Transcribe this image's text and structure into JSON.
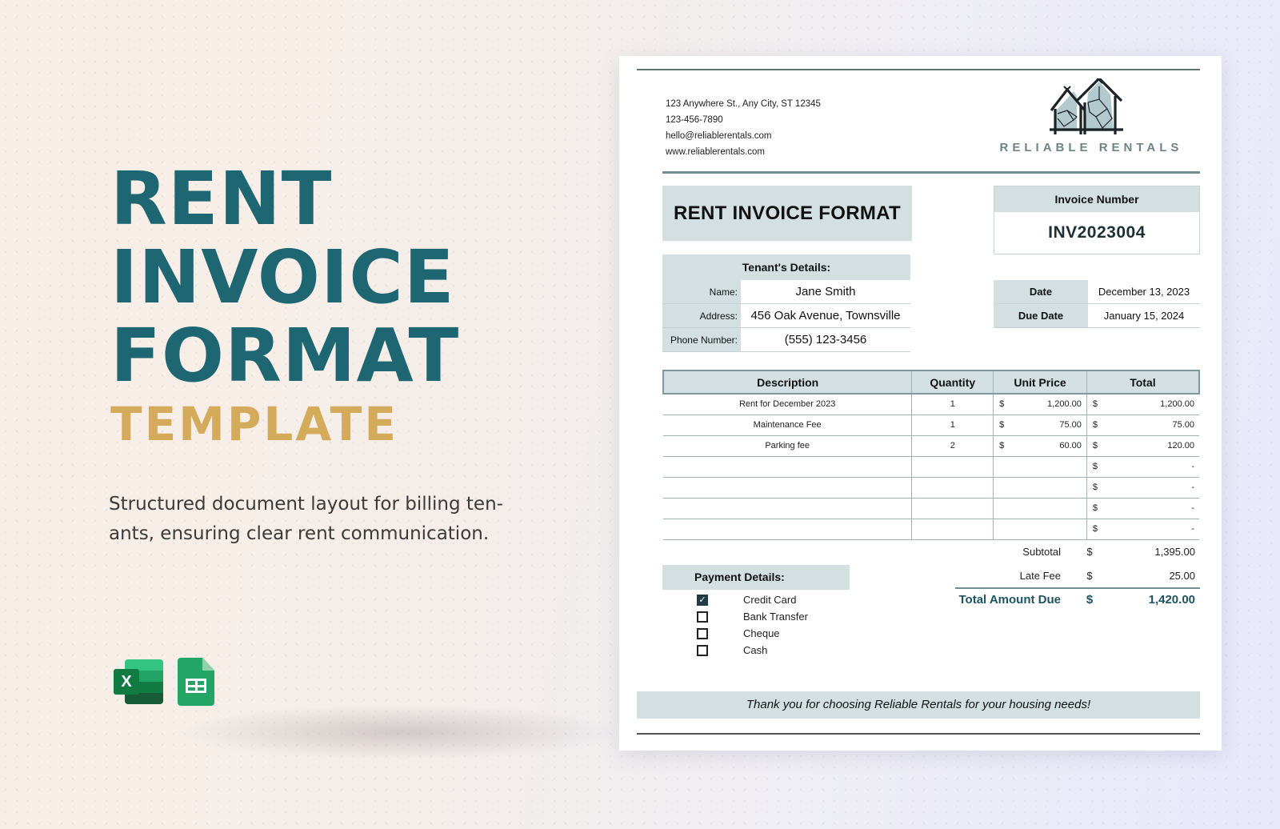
{
  "hero": {
    "title_lines": [
      "RENT",
      "INVOICE",
      "FORMAT"
    ],
    "subtitle": "TEMPLATE",
    "description_lines": [
      "Structured document layout for billing ten-",
      "ants, ensuring clear rent communication."
    ],
    "app_icons": [
      {
        "name": "excel-icon",
        "glyph": "X"
      },
      {
        "name": "google-sheets-icon"
      }
    ],
    "colors": {
      "title": "#1d6672",
      "subtitle": "#d4aa5b"
    }
  },
  "invoice": {
    "contact": {
      "address": "123 Anywhere St., Any City, ST 12345",
      "phone": "123-456-7890",
      "email": "hello@reliablerentals.com",
      "website": "www.reliablerentals.com"
    },
    "brand": {
      "name": "RELIABLE RENTALS",
      "logo_icon": "houses-logo-icon"
    },
    "title": "RENT INVOICE FORMAT",
    "invoice_number": {
      "label": "Invoice Number",
      "value": "INV2023004"
    },
    "tenant": {
      "heading": "Tenant's Details:",
      "fields": [
        {
          "label": "Name:",
          "value": "Jane Smith"
        },
        {
          "label": "Address:",
          "value": "456 Oak Avenue, Townsville"
        },
        {
          "label": "Phone Number:",
          "value": "(555) 123-3456"
        }
      ]
    },
    "dates": [
      {
        "label": "Date",
        "value": "December 13, 2023"
      },
      {
        "label": "Due Date",
        "value": "January 15, 2024"
      }
    ],
    "table": {
      "headers": [
        "Description",
        "Quantity",
        "Unit Price",
        "Total"
      ],
      "rows": [
        {
          "description": "Rent for December 2023",
          "quantity": "1",
          "unit_currency": "$",
          "unit_price": "1,200.00",
          "total_currency": "$",
          "total": "1,200.00"
        },
        {
          "description": "Maintenance Fee",
          "quantity": "1",
          "unit_currency": "$",
          "unit_price": "75.00",
          "total_currency": "$",
          "total": "75.00"
        },
        {
          "description": "Parking fee",
          "quantity": "2",
          "unit_currency": "$",
          "unit_price": "60.00",
          "total_currency": "$",
          "total": "120.00"
        },
        {
          "description": "",
          "quantity": "",
          "unit_currency": "",
          "unit_price": "",
          "total_currency": "$",
          "total": "-"
        },
        {
          "description": "",
          "quantity": "",
          "unit_currency": "",
          "unit_price": "",
          "total_currency": "$",
          "total": "-"
        },
        {
          "description": "",
          "quantity": "",
          "unit_currency": "",
          "unit_price": "",
          "total_currency": "$",
          "total": "-"
        },
        {
          "description": "",
          "quantity": "",
          "unit_currency": "",
          "unit_price": "",
          "total_currency": "$",
          "total": "-"
        }
      ]
    },
    "summary": [
      {
        "label": "Subtotal",
        "currency": "$",
        "amount": "1,395.00"
      },
      {
        "label": "Late Fee",
        "currency": "$",
        "amount": "25.00"
      },
      {
        "label": "Total Amount Due",
        "currency": "$",
        "amount": "1,420.00"
      }
    ],
    "payment": {
      "heading": "Payment Details:",
      "options": [
        {
          "label": "Credit Card",
          "checked": true
        },
        {
          "label": "Bank Transfer",
          "checked": false
        },
        {
          "label": "Cheque",
          "checked": false
        },
        {
          "label": "Cash",
          "checked": false
        }
      ]
    },
    "footer_note": "Thank you for choosing Reliable Rentals for your housing needs!",
    "colors": {
      "header_fill": "#d3dfe1",
      "accent": "#1d5560",
      "rule": "#6e9095"
    }
  }
}
